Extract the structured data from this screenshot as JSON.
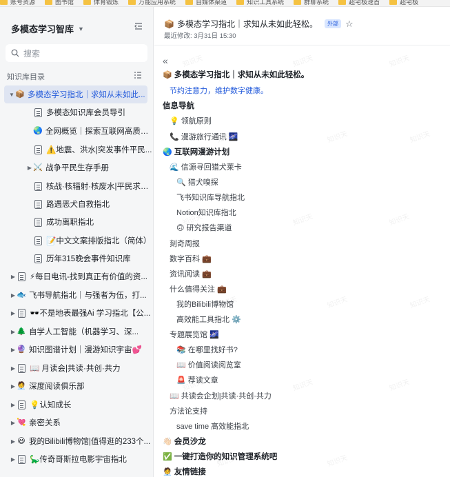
{
  "bookmarks": [
    "账号资源",
    "图书馆",
    "体育锻炼",
    "万能应用系统",
    "自媒体渠道",
    "知识工具系统",
    "群聊系统",
    "超宅极速首",
    "超宅极"
  ],
  "sidebar": {
    "kb_title": "多模态学习智库",
    "search_placeholder": "搜索",
    "toc_label": "知识库目录",
    "items": [
      {
        "label": "多模态学习指北｜求知从未如此...",
        "emoji": "📦",
        "arrow": "▼",
        "icon": "package-emoji"
      },
      {
        "label": "多模态知识库会员导引",
        "emoji": "",
        "arrow": "",
        "icon": "document-icon"
      },
      {
        "label": "全网概览｜探索互联网高质量...",
        "emoji": "🌏",
        "arrow": "",
        "icon": "globe-emoji"
      },
      {
        "label": "⚠️地震、洪水|突发事件平民...",
        "emoji": "",
        "arrow": "",
        "icon": "document-icon"
      },
      {
        "label": "战争平民生存手册",
        "emoji": "⚔️",
        "arrow": "▶",
        "icon": "swords-emoji"
      },
      {
        "label": "核战·核辐射·核废水|平民求生...",
        "emoji": "",
        "arrow": "",
        "icon": "document-icon"
      },
      {
        "label": "路遇恶犬自救指北",
        "emoji": "",
        "arrow": "",
        "icon": "document-icon"
      },
      {
        "label": "成功离职指北",
        "emoji": "",
        "arrow": "",
        "icon": "document-icon"
      },
      {
        "label": "📝中文文案排版指北（简体）",
        "emoji": "",
        "arrow": "",
        "icon": "document-icon"
      },
      {
        "label": "历年315晚会事件知识库",
        "emoji": "",
        "arrow": "",
        "icon": "table-icon"
      },
      {
        "label": "⚡每日电讯-找到真正有价值的资...",
        "emoji": "",
        "arrow": "▶",
        "icon": "document-icon"
      },
      {
        "label": "飞书导航指北｜与强者为伍，打...",
        "emoji": "🐟",
        "arrow": "▶",
        "icon": "fish-emoji"
      },
      {
        "label": "🕶️不是地表最强Ai 学习指北【公...",
        "emoji": "",
        "arrow": "▶",
        "icon": "document-icon"
      },
      {
        "label": "自学人工智能（机器学习、深...",
        "emoji": "🌲",
        "arrow": "▶",
        "icon": "tree-emoji"
      },
      {
        "label": "知识图谱计划｜漫游知识宇宙💕",
        "emoji": "🔮",
        "arrow": "▶",
        "icon": "crystal-emoji"
      },
      {
        "label": "📖 月读会|共读·共创·共力",
        "emoji": "",
        "arrow": "▶",
        "icon": "document-icon"
      },
      {
        "label": "深度阅读俱乐部",
        "emoji": "🧑‍💼",
        "arrow": "▶",
        "icon": "person-emoji"
      },
      {
        "label": "💡认知成长",
        "emoji": "",
        "arrow": "▶",
        "icon": "document-icon"
      },
      {
        "label": "亲密关系",
        "emoji": "💘",
        "arrow": "▶",
        "icon": "heart-emoji"
      },
      {
        "label": "我的Bilibili博物馆|值得逛的233个...",
        "emoji": "😃",
        "arrow": "▶",
        "icon": "smile-emoji"
      },
      {
        "label": "🦕传奇哥斯拉电影宇宙指北",
        "emoji": "",
        "arrow": "▶",
        "icon": "document-icon"
      }
    ]
  },
  "main": {
    "title_emoji": "📦",
    "title": "多模态学习指北｜求知从未如此轻松。",
    "tag": "外部",
    "modified": "最近修改: 3月31日 15:30",
    "collapse": "«",
    "watermark": "知识天",
    "lines": [
      {
        "text": "多模态学习指北｜求知从未如此轻松。",
        "pre": "📦",
        "post": "",
        "bold": true,
        "link": false,
        "indent": 0
      },
      {
        "text": "节约注意力，维护数字健康。",
        "pre": "",
        "post": "",
        "bold": false,
        "link": true,
        "indent": 1
      },
      {
        "text": "信息导航",
        "pre": "",
        "post": "",
        "bold": true,
        "link": false,
        "indent": 0
      },
      {
        "text": "领航原则",
        "pre": "💡",
        "post": "",
        "bold": false,
        "link": false,
        "indent": 1
      },
      {
        "text": "漫游旅行通讯",
        "pre": "📞",
        "post": "🌌",
        "bold": false,
        "link": false,
        "indent": 1
      },
      {
        "text": "互联网漫游计划",
        "pre": "🌏",
        "post": "",
        "bold": true,
        "link": false,
        "indent": 0
      },
      {
        "text": "信源寻回猎犬莱卡",
        "pre": "🌊",
        "post": "",
        "bold": false,
        "link": false,
        "indent": 1
      },
      {
        "text": "猎犬嗅探",
        "pre": "🔍",
        "post": "",
        "bold": false,
        "link": false,
        "indent": 2
      },
      {
        "text": "飞书知识库导航指北",
        "pre": "",
        "post": "",
        "bold": false,
        "link": false,
        "indent": 2
      },
      {
        "text": "Notion知识库指北",
        "pre": "",
        "post": "",
        "bold": false,
        "link": false,
        "indent": 2
      },
      {
        "text": "研究报告渠道",
        "pre": "🙃",
        "post": "",
        "bold": false,
        "link": false,
        "indent": 2
      },
      {
        "text": "刻奇周报",
        "pre": "",
        "post": "",
        "bold": false,
        "link": false,
        "indent": 1
      },
      {
        "text": "数字百科",
        "pre": "",
        "post": "💼",
        "bold": false,
        "link": false,
        "indent": 1
      },
      {
        "text": "资讯阅读",
        "pre": "",
        "post": "💼",
        "bold": false,
        "link": false,
        "indent": 1
      },
      {
        "text": "什么值得关注",
        "pre": "",
        "post": "💼",
        "bold": false,
        "link": false,
        "indent": 1
      },
      {
        "text": "我的Bilibili博物馆",
        "pre": "",
        "post": "",
        "bold": false,
        "link": false,
        "indent": 2
      },
      {
        "text": "高效能工具指北",
        "pre": "",
        "post": "⚙️",
        "bold": false,
        "link": false,
        "indent": 2
      },
      {
        "text": "专题展览馆",
        "pre": "",
        "post": "🌌",
        "bold": false,
        "link": false,
        "indent": 1
      },
      {
        "text": "在哪里找好书?",
        "pre": "📚",
        "post": "",
        "bold": false,
        "link": false,
        "indent": 2
      },
      {
        "text": "价值阅读阅览室",
        "pre": "📖",
        "post": "",
        "bold": false,
        "link": false,
        "indent": 2
      },
      {
        "text": "荐读文章",
        "pre": "🚨",
        "post": "",
        "bold": false,
        "link": false,
        "indent": 2
      },
      {
        "text": "共读会企划|共读·共创·共力",
        "pre": "📖",
        "post": "",
        "bold": false,
        "link": false,
        "indent": 1
      },
      {
        "text": "方法论支持",
        "pre": "",
        "post": "",
        "bold": false,
        "link": false,
        "indent": 1
      },
      {
        "text": "save time 高效能指北",
        "pre": "",
        "post": "",
        "bold": false,
        "link": false,
        "indent": 2
      },
      {
        "text": "会员沙龙",
        "pre": "👋🏻",
        "post": "",
        "bold": true,
        "link": false,
        "indent": 0
      },
      {
        "text": "一键打造你的知识管理系统吧",
        "pre": "✅",
        "post": "",
        "bold": true,
        "link": false,
        "indent": 0
      },
      {
        "text": "友情链接",
        "pre": "🧑‍💼",
        "post": "",
        "bold": true,
        "link": false,
        "indent": 0
      }
    ]
  }
}
